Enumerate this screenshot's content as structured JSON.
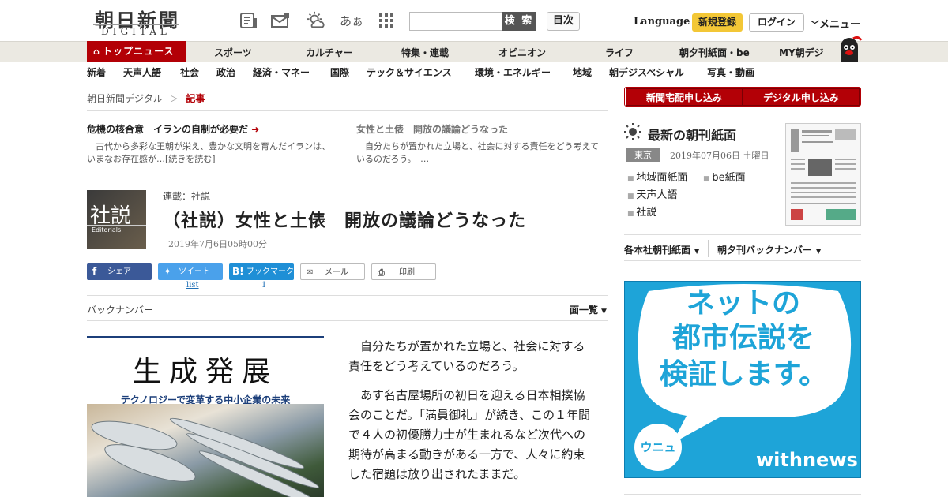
{
  "header": {
    "logo_main": "朝日新聞",
    "logo_sub": "DIGITAL",
    "icons": [
      "newspaper-icon",
      "mail-icon",
      "weather-icon",
      "font-size-icon",
      "grid-icon"
    ],
    "font_icon_text": "あぁ",
    "search_placeholder": "",
    "search_button": "検 索",
    "toc_button": "目次",
    "language": "Language",
    "signup": "新規登録",
    "login": "ログイン",
    "menu": "メニュー"
  },
  "nav_primary": {
    "top": "トップニュース",
    "items": [
      "スポーツ",
      "カルチャー",
      "特集・連載",
      "オピニオン",
      "ライフ",
      "朝夕刊紙面・be",
      "MY朝デジ"
    ]
  },
  "nav_secondary": [
    "新着",
    "天声人語",
    "社会",
    "政治",
    "経済・マネー",
    "国際",
    "テック＆サイエンス",
    "環境・エネルギー",
    "地域",
    "朝デジスペシャル",
    "写真・動画"
  ],
  "breadcrumb": {
    "home": "朝日新聞デジタル",
    "sep": "＞",
    "current": "記事"
  },
  "related": [
    {
      "title": "危機の核合意　イランの自制が必要だ",
      "desc": "　古代から多彩な王朝が栄え、豊かな文明を育んだイランは、いまなお存在感が…[続きを読む]"
    },
    {
      "title": "女性と土俵　開放の議論どうなった",
      "desc": "　自分たちが置かれた立場と、社会に対する責任をどう考えているのだろう。　…"
    }
  ],
  "article": {
    "thumb_text": "社説",
    "thumb_sub": "Editorials",
    "series": "連載：社説",
    "title": "（社説）女性と土俵　開放の議論どうなった",
    "date": "2019年7月6日05時00分",
    "share": {
      "share": "シェア",
      "tweet": "ツイート",
      "bookmark": "ブックマーク",
      "mail": "メール",
      "print": "印刷",
      "tweet_count": "list",
      "bookmark_count": "1"
    },
    "backnumber": "バックナンバー",
    "all_list": "面一覧",
    "paragraphs": [
      "自分たちが置かれた立場と、社会に対する責任をどう考えているのだろう。",
      "あす名古屋場所の初日を迎える日本相撲協会のことだ。「満員御礼」が続き、この１年間で４人の初優勝力士が生まれるなど次代への期待が高まる動きがある一方で、人々に約束した宿題は放り出されたままだ。"
    ]
  },
  "ad_left": {
    "title": "生成発展",
    "subtitle": "テクノロジーで変革する中小企業の未来"
  },
  "sidebar": {
    "subscribe_home": "新聞宅配申し込み",
    "subscribe_digital": "デジタル申し込み",
    "latest_title": "最新の朝刊紙面",
    "region": "東京",
    "paper_date": "2019年07月06日 土曜日",
    "links": [
      "地域面紙面",
      "be紙面",
      "天声人語",
      "社説"
    ],
    "dropdown1": "各本社朝刊紙面",
    "dropdown2": "朝夕刊バックナンバー"
  },
  "ad_right": {
    "line1": "ネットの",
    "line2": "都市伝説を",
    "line3": "検証します。",
    "badge": "ウニュ",
    "brand": "withnews"
  },
  "colors": {
    "brand_red": "#b30006",
    "signup_yellow": "#f3c736",
    "ad_blue": "#1ea4d8"
  }
}
